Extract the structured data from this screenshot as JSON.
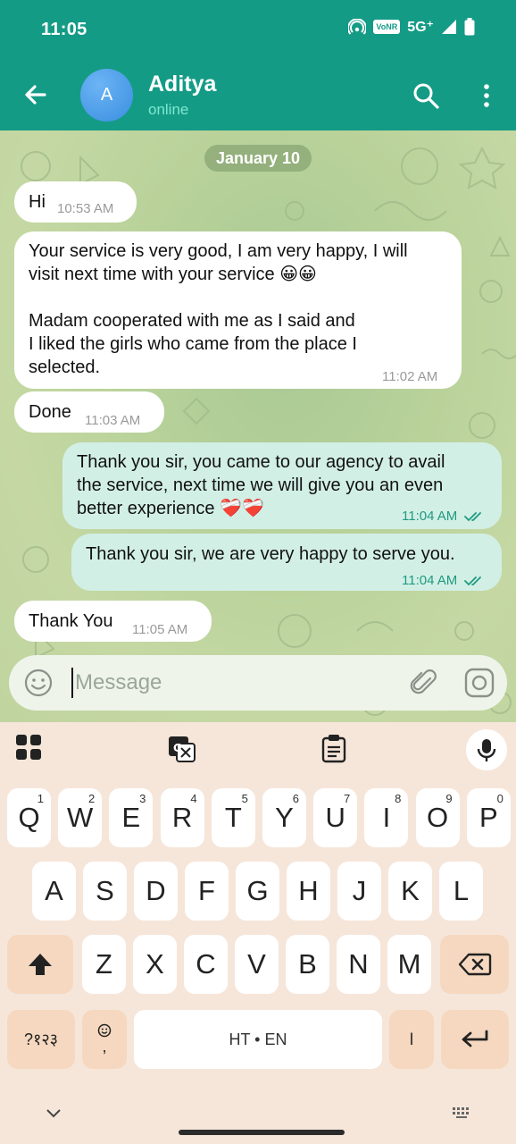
{
  "status_bar": {
    "time": "11:05",
    "volte": "VoNR",
    "network": "5G⁺"
  },
  "header": {
    "avatar_letter": "A",
    "contact_name": "Aditya",
    "contact_status": "online"
  },
  "chat": {
    "date_chip": "January 10",
    "messages": [
      {
        "dir": "in",
        "text": "Hi",
        "time": "10:53 AM"
      },
      {
        "dir": "in",
        "text": "Your service is very good, I am very happy, I will\nvisit next time with your service 😀😀\n\nMadam cooperated with me as I said and\nI liked the girls who came from the place I\nselected.",
        "time": "11:02 AM"
      },
      {
        "dir": "in",
        "text": "Done",
        "time": "11:03 AM"
      },
      {
        "dir": "out",
        "text": "Thank you sir, you came to our agency to avail\nthe service, next time we will give you an even\nbetter experience ❤️‍🩹❤️‍🩹",
        "time": "11:04 AM"
      },
      {
        "dir": "out",
        "text": "Thank you sir, we are very happy to serve you.",
        "time": "11:04 AM"
      },
      {
        "dir": "in",
        "text": "Thank You",
        "time": "11:05 AM"
      }
    ]
  },
  "input": {
    "placeholder": "Message"
  },
  "keyboard": {
    "row1": [
      {
        "letter": "Q",
        "hint": "1"
      },
      {
        "letter": "W",
        "hint": "2"
      },
      {
        "letter": "E",
        "hint": "3"
      },
      {
        "letter": "R",
        "hint": "4"
      },
      {
        "letter": "T",
        "hint": "5"
      },
      {
        "letter": "Y",
        "hint": "6"
      },
      {
        "letter": "U",
        "hint": "7"
      },
      {
        "letter": "I",
        "hint": "8"
      },
      {
        "letter": "O",
        "hint": "9"
      },
      {
        "letter": "P",
        "hint": "0"
      }
    ],
    "row2": [
      "A",
      "S",
      "D",
      "F",
      "G",
      "H",
      "J",
      "K",
      "L"
    ],
    "row3": [
      "Z",
      "X",
      "C",
      "V",
      "B",
      "N",
      "M"
    ],
    "symbols_label": "?१२३",
    "comma_label": ",",
    "space_label": "HT • EN",
    "period_label": "ا"
  },
  "colors": {
    "header": "#149b86",
    "incoming_bubble": "#ffffff",
    "outgoing_bubble": "#d2efe6",
    "keyboard_bg": "#f6e6da",
    "function_key": "#f5d8bf"
  }
}
